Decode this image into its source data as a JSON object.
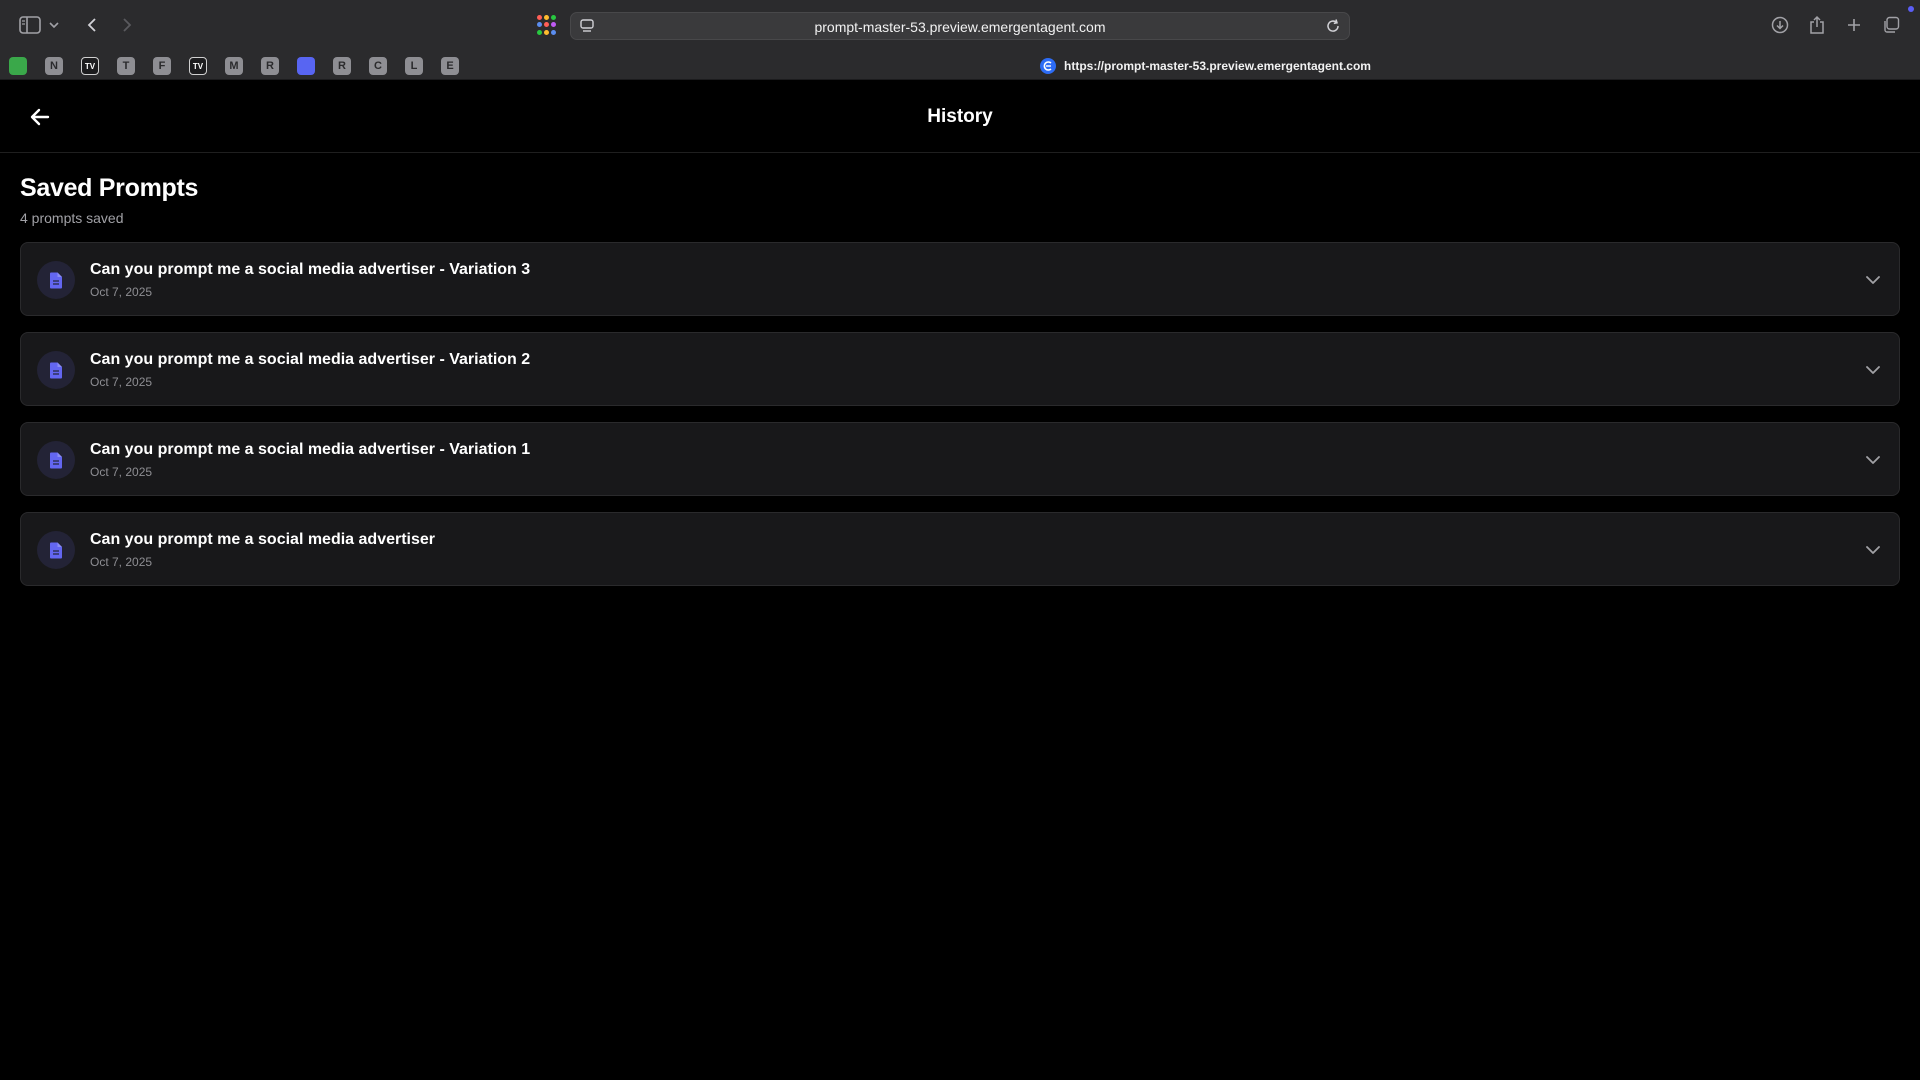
{
  "browser": {
    "url": "prompt-master-53.preview.emergentagent.com",
    "active_tab_url": "https://prompt-master-53.preview.emergentagent.com",
    "bookmarks": [
      "",
      "N",
      "TV",
      "T",
      "F",
      "TV",
      "M",
      "R",
      "",
      "R",
      "C",
      "L",
      "E"
    ]
  },
  "header": {
    "title": "History"
  },
  "section": {
    "title": "Saved Prompts",
    "count_label": "4 prompts saved"
  },
  "prompts": [
    {
      "title": "Can you prompt me a social media advertiser - Variation 3",
      "date": "Oct 7, 2025"
    },
    {
      "title": "Can you prompt me a social media advertiser - Variation 2",
      "date": "Oct 7, 2025"
    },
    {
      "title": "Can you prompt me a social media advertiser - Variation 1",
      "date": "Oct 7, 2025"
    },
    {
      "title": "Can you prompt me a social media advertiser",
      "date": "Oct 7, 2025"
    }
  ],
  "colors": {
    "accent": "#6366f1",
    "background": "#000000",
    "card": "#18181a"
  }
}
